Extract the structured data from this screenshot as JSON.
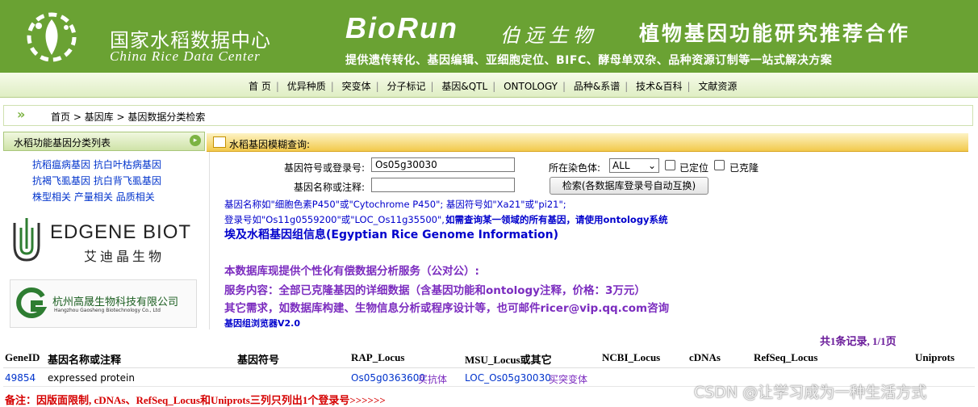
{
  "header": {
    "logo_cn": "国家水稻数据中心",
    "logo_en": "China Rice Data Center",
    "brand_en": "BioRun",
    "brand_cn": "伯远生物",
    "ad_title": "植物基因功能研究推荐合作",
    "ad_subtitle": "提供遗传转化、基因编辑、亚细胞定位、BIFC、酵母单双杂、品种资源订制等一站式解决方案"
  },
  "nav": {
    "items": [
      "首 页",
      "优异种质",
      "突变体",
      "分子标记",
      "基因&QTL",
      "ONTOLOGY",
      "品种&系谱",
      "技术&百科",
      "文献资源"
    ]
  },
  "breadcrumb": "首页 > 基因库 > 基因数据分类检索",
  "sidebar": {
    "title": "水稻功能基因分类列表",
    "links": [
      [
        "抗稻瘟病基因",
        "抗白叶枯病基因"
      ],
      [
        "抗褐飞虱基因",
        "抗白背飞虱基因"
      ],
      [
        "株型相关",
        "产量相关",
        "品质相关"
      ]
    ],
    "ad1_en": "EDGENE BIOT",
    "ad1_cn": "艾迪晶生物",
    "ad2_cn": "杭州高晟生物科技有限公司",
    "ad2_en": "Hangzhou Gaosheng Biotechnology Co., Ltd"
  },
  "query": {
    "title": "水稻基因模糊查询:",
    "symbol_label": "基因符号或登录号:",
    "symbol_value": "Os05g30030",
    "name_label": "基因名称或注释:",
    "name_value": "",
    "chrom_label": "所在染色体:",
    "chrom_value": "ALL",
    "located_label": "已定位",
    "cloned_label": "已克隆",
    "search_button": "检索(各数据库登录号自动互换)",
    "hint1": "基因名称如\"细胞色素P450\"或\"Cytochrome P450\"; 基因符号如\"Xa21\"或\"pi21\";",
    "hint2a": "登录号如\"Os11g0559200\"或\"LOC_Os11g35500\",",
    "hint2b": "如需查询某一领域的所有基因，请使用ontology系统",
    "egypt": "埃及水稻基因组信息(Egyptian Rice Genome Information)",
    "service1": "本数据库现提供个性化有偿数据分析服务（公对公）:",
    "service2": "服务内容：全部已克隆基因的详细数据（含基因功能和ontology注释，价格：3万元）",
    "service3": "其它需求，如数据库构建、生物信息分析或程序设计等，也可邮件ricer@vip.qq.com咨询",
    "browser": "基因组浏览器V2.0"
  },
  "results": {
    "record_info": "共1条记录, 1/1页",
    "columns": [
      "GeneID",
      "基因名称或注释",
      "基因符号",
      "RAP_Locus",
      "MSU_Locus或其它",
      "NCBI_Locus",
      "cDNAs",
      "RefSeq_Locus",
      "Uniprots"
    ],
    "rows": [
      {
        "gene_id": "49854",
        "name": "expressed protein",
        "symbol": "",
        "rap": "Os05g0363600",
        "rap_extra": "买抗体",
        "msu": "LOC_Os05g30030",
        "msu_extra": "买突变体",
        "ncbi": "",
        "cdnas": "",
        "refseq": "",
        "uniprots": ""
      }
    ],
    "note": "备注：因版面限制, cDNAs、RefSeq_Locus和Uniprots三列只列出1个登录号>>>>>>"
  },
  "watermark": "CSDN @让学习成为一种生活方式",
  "colors": {
    "banner": "#6aa233",
    "link": "#0033cc",
    "purple": "#7b2cbf",
    "note_red": "#d50000"
  }
}
